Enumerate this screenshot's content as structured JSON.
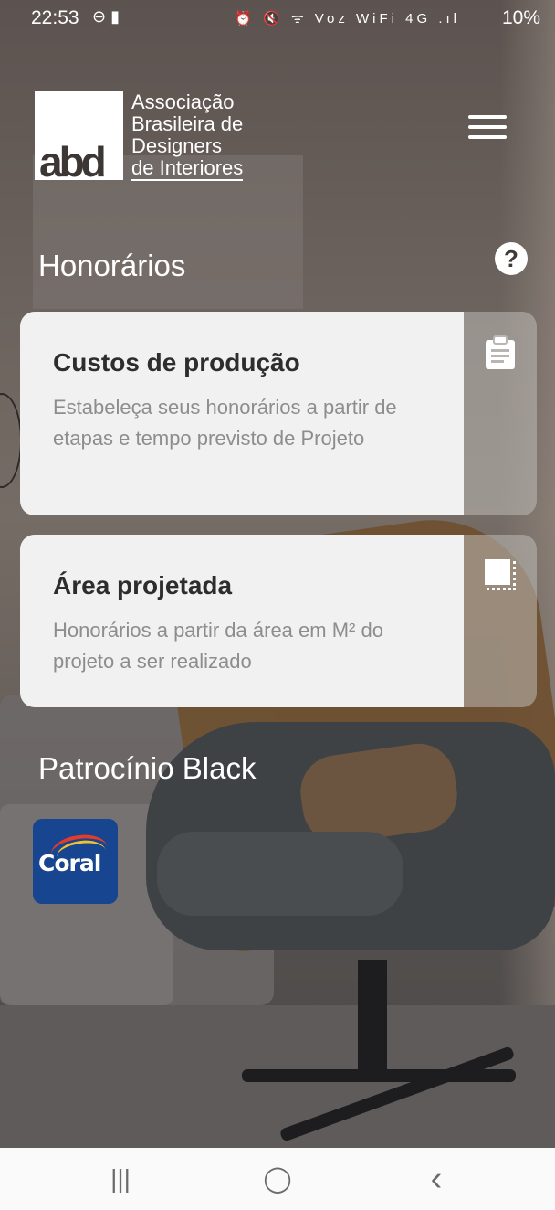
{
  "status": {
    "time": "22:53",
    "left_icons": "⊖ ▮",
    "right_icons": "⏰ 🔇 ᯤ Voz WiFi 4G .ıl",
    "battery": "10%"
  },
  "logo": {
    "mark": "abd",
    "line1": "Associação",
    "line2": "Brasileira de",
    "line3": "Designers",
    "line4": "de Interiores"
  },
  "header": {
    "menu_icon": "hamburger-menu-icon"
  },
  "section1": {
    "title": "Honorários",
    "help_glyph": "?"
  },
  "cards": [
    {
      "title": "Custos de produção",
      "description": "Estabeleça seus honorários a partir de etapas e tempo previsto de Projeto",
      "icon": "clipboard-icon"
    },
    {
      "title": "Área projetada",
      "description": "Honorários a partir da área em M² do projeto a ser realizado",
      "icon": "area-square-icon"
    }
  ],
  "section2": {
    "title": "Patrocínio Black"
  },
  "sponsor": {
    "name": "Coral"
  },
  "nav": {
    "recent": "|||",
    "home": "◯",
    "back": "‹"
  }
}
